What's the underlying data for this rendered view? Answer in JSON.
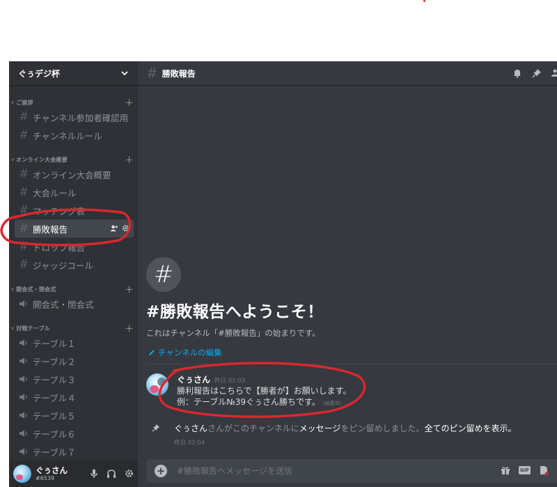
{
  "guild": {
    "name": "ぐぅデジ杯"
  },
  "categories": [
    {
      "name": "ご挨拶",
      "channels": [
        {
          "name": "チャンネル参加者確認用"
        },
        {
          "name": "チャンネルルール"
        }
      ]
    },
    {
      "name": "オンライン大会概要",
      "channels": [
        {
          "name": "オンライン大会概要"
        },
        {
          "name": "大会ルール"
        },
        {
          "name": "マッチング表"
        },
        {
          "name": "勝敗報告"
        },
        {
          "name": "ドロップ報告"
        },
        {
          "name": "ジャッジコール"
        }
      ]
    },
    {
      "name": "開会式・閉会式",
      "channels": [
        {
          "name": "開会式・閉会式"
        }
      ]
    },
    {
      "name": "対戦テーブル",
      "channels": [
        {
          "name": "テーブル１"
        },
        {
          "name": "テーブル２"
        },
        {
          "name": "テーブル３"
        },
        {
          "name": "テーブル４"
        },
        {
          "name": "テーブル５"
        },
        {
          "name": "テーブル６"
        },
        {
          "name": "テーブル７"
        }
      ]
    }
  ],
  "user": {
    "name": "ぐぅさん",
    "tag": "#6539"
  },
  "channel": {
    "name": "勝敗報告"
  },
  "welcome": {
    "title": "#勝敗報告へようこそ！",
    "subtitle": "これはチャンネル「#勝敗報告」の始まりです。",
    "edit_label": "チャンネルの編集"
  },
  "message": {
    "author": "ぐぅさん",
    "time": "昨日 01:03",
    "line1": "勝利報告はこちらで【勝者が】お願いします。",
    "line2": "例：テーブル№39ぐぅさん勝ちです。",
    "edited": "(編集済)"
  },
  "pin": {
    "actor": "ぐぅさん",
    "text1": "さんがこのチャンネルに",
    "link": "メッセージ",
    "text2": "をピン留めしました。",
    "show_all": "全てのピン留めを表示。",
    "time": "昨日 01:04"
  },
  "input": {
    "placeholder": "#勝敗報告へメッセージを送信"
  },
  "icons": {
    "hash": "#",
    "plus": "+",
    "add": "+",
    "gif": "GIF",
    "cat_chevron": "v"
  },
  "colors": {
    "sidebar": "#2f3136",
    "main": "#36393f",
    "active_channel": "#42464d",
    "link": "#00b0f4",
    "annotation": "#d9282f"
  }
}
